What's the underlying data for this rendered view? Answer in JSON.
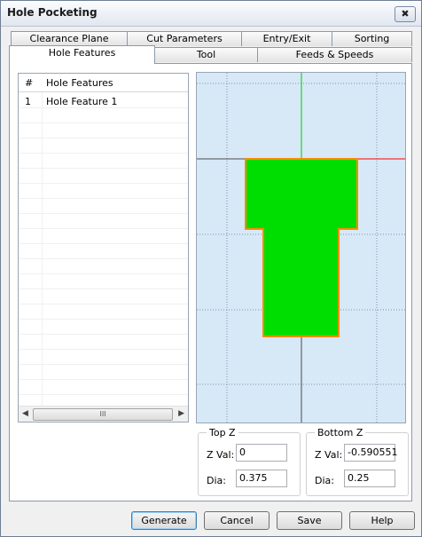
{
  "window": {
    "title": "Hole Pocketing",
    "close_label": "✖"
  },
  "tabs_row1": [
    "Clearance Plane",
    "Cut Parameters",
    "Entry/Exit",
    "Sorting"
  ],
  "tabs_row2": [
    "Hole Features",
    "Tool",
    "Feeds & Speeds"
  ],
  "active_tab": "Hole Features",
  "list": {
    "columns": [
      "#",
      "Hole Features"
    ],
    "rows": [
      {
        "num": "1",
        "name": "Hole Feature 1"
      }
    ],
    "scroll_left": "◀",
    "scroll_right": "▶",
    "scroll_thumb": "III"
  },
  "preview": {
    "background": "#d7e8f7",
    "fill_color": "#00dd00",
    "outline_color": "#ff8c00",
    "x_axis_color": "#ff0000",
    "y_axis_color": "#00cc00"
  },
  "top_z": {
    "title": "Top Z",
    "zval_label": "Z Val:",
    "zval": "0",
    "dia_label": "Dia:",
    "dia": "0.375"
  },
  "bottom_z": {
    "title": "Bottom Z",
    "zval_label": "Z Val:",
    "zval": "-0.590551",
    "dia_label": "Dia:",
    "dia": "0.25"
  },
  "buttons": {
    "generate": "Generate",
    "cancel": "Cancel",
    "save": "Save",
    "help": "Help"
  }
}
